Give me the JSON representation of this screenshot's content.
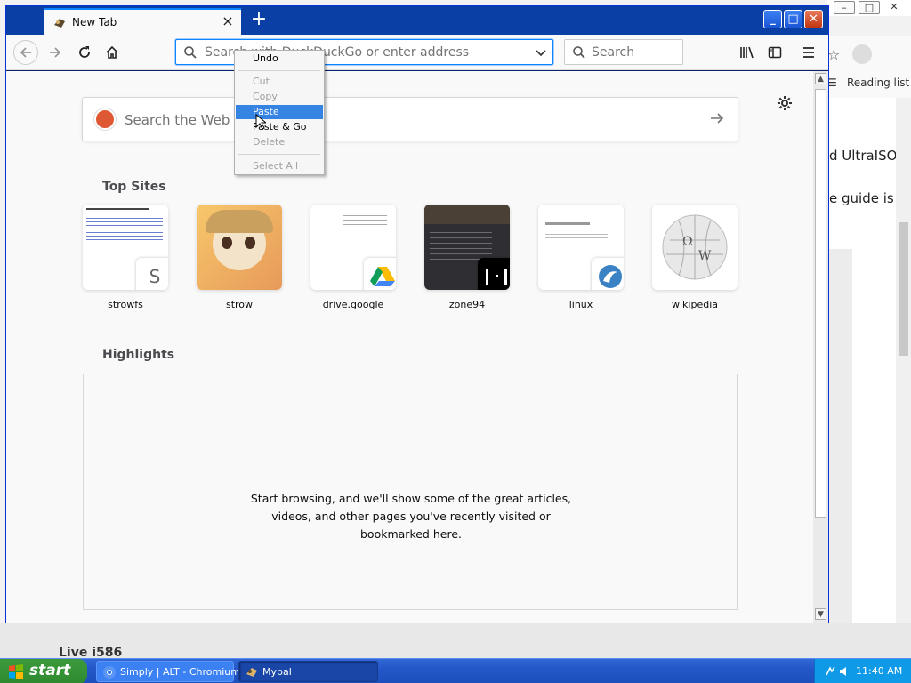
{
  "background": {
    "window_controls": [
      "–",
      "□",
      "✕"
    ],
    "star": "☆",
    "reading_list": "Reading list",
    "text_line1": "d UltraISO",
    "text_line2": "e guide is",
    "bottom_text": "Live i586"
  },
  "tab": {
    "title": "New Tab",
    "close": "×"
  },
  "newtab": "+",
  "window_buttons": [
    "_",
    "□",
    "✕"
  ],
  "navbar": {
    "url_placeholder": "Search with DuckDuckGo or enter address",
    "search_placeholder": "Search"
  },
  "page": {
    "search_web_placeholder": "Search the Web",
    "top_sites_title": "Top Sites",
    "top_sites": [
      {
        "label": "strowfs",
        "badge": "S"
      },
      {
        "label": "strow"
      },
      {
        "label": "drive.google"
      },
      {
        "label": "zone94"
      },
      {
        "label": "linux"
      },
      {
        "label": "wikipedia"
      }
    ],
    "highlights_title": "Highlights",
    "highlights_msg_1": "Start browsing, and we'll show some of the great articles,",
    "highlights_msg_2": "videos, and other pages you've recently visited or",
    "highlights_msg_3": "bookmarked here."
  },
  "context_menu": {
    "undo": "Undo",
    "cut": "Cut",
    "copy": "Copy",
    "paste": "Paste",
    "paste_go": "Paste & Go",
    "delete": "Delete",
    "select_all": "Select All"
  },
  "taskbar": {
    "start": "start",
    "tasks": [
      {
        "label": "Simply | ALT - Chromium"
      },
      {
        "label": "Mypal"
      }
    ],
    "clock": "11:40 AM"
  },
  "colors": {
    "accent": "#0a84ff",
    "highlight": "#3584e4",
    "xp_blue": "#2457c8",
    "start_green": "#3c9a3c"
  }
}
